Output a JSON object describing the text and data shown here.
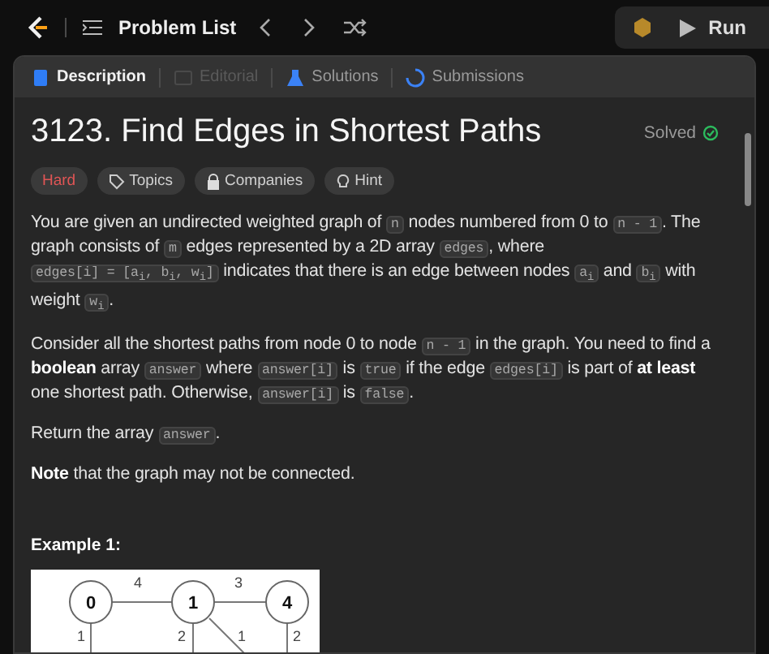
{
  "topbar": {
    "title": "Problem List",
    "run_label": "Run"
  },
  "tabs": [
    {
      "label": "Description",
      "selected": true,
      "disabled": false
    },
    {
      "label": "Editorial",
      "selected": false,
      "disabled": true
    },
    {
      "label": "Solutions",
      "selected": false,
      "disabled": false
    },
    {
      "label": "Submissions",
      "selected": false,
      "disabled": false
    }
  ],
  "problem": {
    "title": "3123. Find Edges in Shortest Paths",
    "status": "Solved",
    "tags": [
      {
        "label": "Hard",
        "kind": "difficulty"
      },
      {
        "label": "Topics",
        "kind": "tag"
      },
      {
        "label": "Companies",
        "kind": "lock"
      },
      {
        "label": "Hint",
        "kind": "bulb"
      }
    ],
    "paragraphs": [
      [
        {
          "kind": "text",
          "text": "You are given an undirected weighted graph of "
        },
        {
          "kind": "code",
          "text": "n"
        },
        {
          "kind": "text",
          "text": " nodes numbered from 0 to "
        },
        {
          "kind": "code",
          "text": "n - 1"
        },
        {
          "kind": "text",
          "text": ". The graph consists of "
        },
        {
          "kind": "code",
          "text": "m"
        },
        {
          "kind": "text",
          "text": " edges represented by a 2D array "
        },
        {
          "kind": "code",
          "text": "edges"
        },
        {
          "kind": "text",
          "text": ", where "
        },
        {
          "kind": "code",
          "text": "edges[i] = [a$_{i}$, b$_{i}$, w$_{i}$]"
        },
        {
          "kind": "text",
          "text": " indicates that there is an edge between nodes "
        },
        {
          "kind": "code",
          "text": "a$_{i}$"
        },
        {
          "kind": "text",
          "text": " and "
        },
        {
          "kind": "code",
          "text": "b$_{i}$"
        },
        {
          "kind": "text",
          "text": " with weight "
        },
        {
          "kind": "code",
          "text": "w$_{i}$"
        },
        {
          "kind": "text",
          "text": "."
        }
      ],
      [
        {
          "kind": "text",
          "text": "Consider all the shortest paths from node 0 to node "
        },
        {
          "kind": "code",
          "text": "n - 1"
        },
        {
          "kind": "text",
          "text": " in the graph. You need to find a **boolean** array "
        },
        {
          "kind": "code",
          "text": "answer"
        },
        {
          "kind": "text",
          "text": " where "
        },
        {
          "kind": "code",
          "text": "answer[i]"
        },
        {
          "kind": "text",
          "text": " is "
        },
        {
          "kind": "code",
          "text": "true"
        },
        {
          "kind": "text",
          "text": " if the edge "
        },
        {
          "kind": "code",
          "text": "edges[i]"
        },
        {
          "kind": "text",
          "text": " is part of **at least** one shortest path. Otherwise, "
        },
        {
          "kind": "code",
          "text": "answer[i]"
        },
        {
          "kind": "text",
          "text": " is "
        },
        {
          "kind": "code",
          "text": "false"
        },
        {
          "kind": "text",
          "text": "."
        }
      ],
      [
        {
          "kind": "text",
          "text": "Return the array "
        },
        {
          "kind": "code",
          "text": "answer"
        },
        {
          "kind": "text",
          "text": "."
        }
      ],
      [
        {
          "kind": "text",
          "text": "**Note** that the graph may not be connected."
        }
      ]
    ],
    "example": {
      "title": "Example 1:",
      "nodes": [
        {
          "label": "0"
        },
        {
          "label": "1"
        },
        {
          "label": "4"
        }
      ],
      "edges": [
        {
          "weight": "4"
        },
        {
          "weight": "3"
        },
        {
          "weight": "1"
        },
        {
          "weight": "2"
        },
        {
          "weight": "1"
        },
        {
          "weight": "2"
        }
      ]
    }
  }
}
